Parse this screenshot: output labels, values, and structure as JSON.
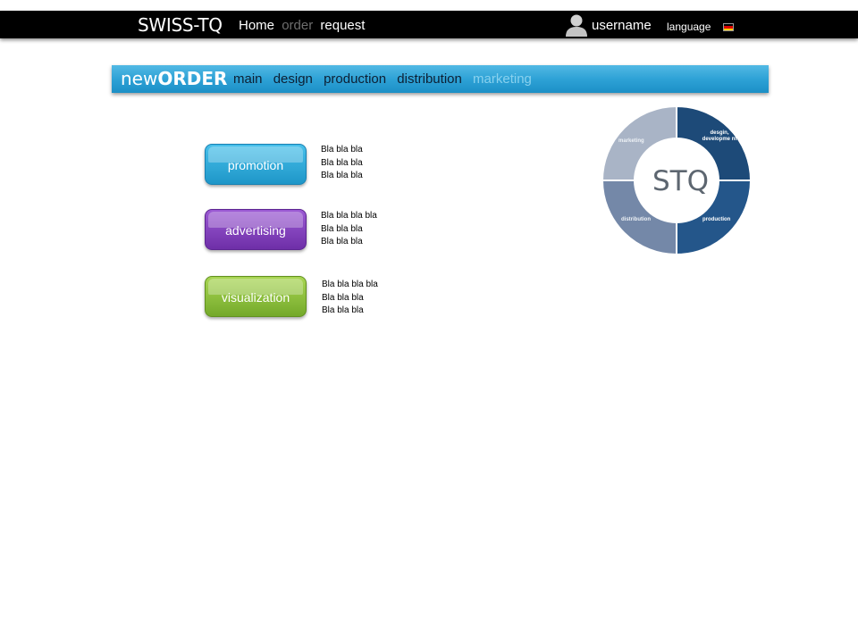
{
  "header": {
    "brand": "SWISS-TQ",
    "nav": [
      {
        "label": "Home",
        "active": true
      },
      {
        "label": "order",
        "active": false
      },
      {
        "label": "request",
        "active": true
      }
    ],
    "username": "username",
    "language": "language",
    "flag_colors": [
      "#000000",
      "#dd0000",
      "#ffce00"
    ]
  },
  "order_bar": {
    "title_light": "new",
    "title_bold": "ORDER",
    "tabs": [
      {
        "label": "main",
        "active": true
      },
      {
        "label": "design",
        "active": true
      },
      {
        "label": "production",
        "active": true
      },
      {
        "label": "distribution",
        "active": true
      },
      {
        "label": "marketing",
        "active": false
      }
    ]
  },
  "categories": [
    {
      "label": "promotion",
      "color": "#2aa6d8",
      "lines": [
        "Bla bla bla",
        "Bla bla bla",
        "Bla bla bla"
      ]
    },
    {
      "label": "advertising",
      "color": "#7d3bbb",
      "lines": [
        "Bla bla bla bla",
        "Bla bla bla",
        "Bla bla bla"
      ]
    },
    {
      "label": "visualization",
      "color": "#8cc13c",
      "lines": [
        "Bla bla bla bla",
        "Bla bla bla",
        "Bla bla bla"
      ]
    }
  ],
  "ring": {
    "center_label": "STQ",
    "segments": [
      {
        "label": "marketing",
        "color": "#a9b4c6"
      },
      {
        "label": "desgin, developme nt",
        "color": "#1d4a78"
      },
      {
        "label": "production",
        "color": "#24568a"
      },
      {
        "label": "distribution",
        "color": "#7488a8"
      }
    ]
  }
}
